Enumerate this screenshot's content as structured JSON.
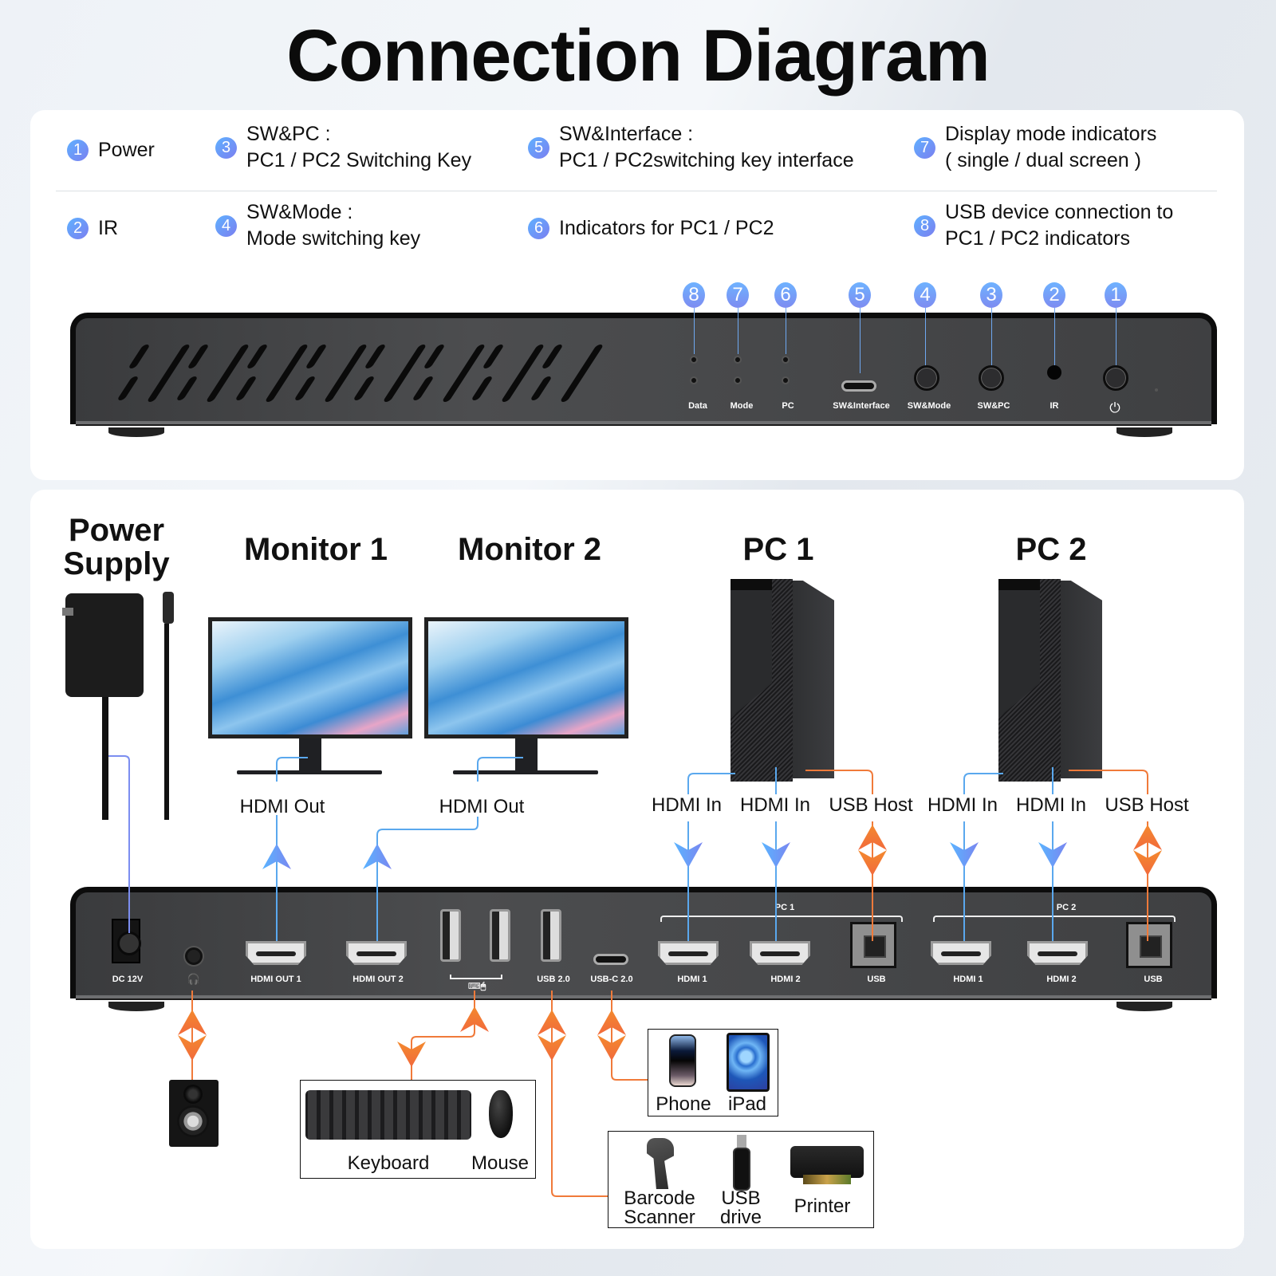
{
  "title": "Connection Diagram",
  "legend": [
    {
      "num": "1",
      "lines": [
        "Power"
      ]
    },
    {
      "num": "2",
      "lines": [
        "IR"
      ]
    },
    {
      "num": "3",
      "lines": [
        "SW&PC :",
        "PC1 / PC2 Switching Key"
      ]
    },
    {
      "num": "4",
      "lines": [
        "SW&Mode :",
        "Mode switching key"
      ]
    },
    {
      "num": "5",
      "lines": [
        "SW&Interface :",
        "PC1 / PC2switching key interface"
      ]
    },
    {
      "num": "6",
      "lines": [
        "Indicators for PC1 / PC2"
      ]
    },
    {
      "num": "7",
      "lines": [
        "Display mode indicators",
        "( single / dual screen )"
      ]
    },
    {
      "num": "8",
      "lines": [
        "USB device connection to",
        "PC1 / PC2 indicators"
      ]
    }
  ],
  "front_panel": {
    "callouts": [
      "8",
      "7",
      "6",
      "5",
      "4",
      "3",
      "2",
      "1"
    ],
    "labels": {
      "data": "Data",
      "mode": "Mode",
      "pc": "PC",
      "sw_interface": "SW&Interface",
      "sw_mode": "SW&Mode",
      "sw_pc": "SW&PC",
      "ir": "IR",
      "power_symbol": "⏻"
    }
  },
  "diagram": {
    "headings": {
      "power_supply": [
        "Power",
        "Supply"
      ],
      "monitor1": "Monitor 1",
      "monitor2": "Monitor 2",
      "pc1": "PC 1",
      "pc2": "PC 2"
    },
    "connection_labels": {
      "monitor1": "HDMI Out",
      "monitor2": "HDMI Out",
      "pc1": [
        "HDMI In",
        "HDMI In",
        "USB Host"
      ],
      "pc2": [
        "HDMI In",
        "HDMI In",
        "USB Host"
      ]
    },
    "rear_panel": {
      "dc": "DC 12V",
      "audio_symbol": "🎧",
      "hdmi_out1": "HDMI OUT 1",
      "hdmi_out2": "HDMI OUT 2",
      "kbm_symbol": "⌨🖱",
      "usb2": "USB 2.0",
      "usbc": "USB-C 2.0",
      "pc1_group": "PC 1",
      "pc2_group": "PC 2",
      "pc1_ports": [
        "HDMI 1",
        "HDMI 2",
        "USB"
      ],
      "pc2_ports": [
        "HDMI 1",
        "HDMI 2",
        "USB"
      ]
    },
    "peripherals": {
      "keyboard": "Keyboard",
      "mouse": "Mouse",
      "phone": "Phone",
      "ipad": "iPad",
      "barcode_scanner": [
        "Barcode",
        "Scanner"
      ],
      "usb_drive": [
        "USB",
        "drive"
      ],
      "printer": "Printer"
    },
    "colors": {
      "video_wire": "#5aa8ee",
      "usb_wire": "#f07a3a",
      "badge_from": "#5fb1ff",
      "badge_to": "#7b7ff0"
    }
  }
}
